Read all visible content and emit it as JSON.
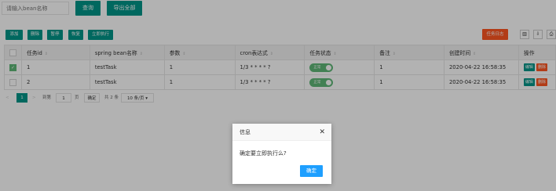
{
  "search": {
    "placeholder": "请输入bean名称",
    "query_label": "查询",
    "export_label": "导出全部"
  },
  "toolbar": {
    "add": "添加",
    "delete": "删除",
    "pause": "暂停",
    "resume": "恢复",
    "run_now": "立即执行",
    "task_log": "任务日志",
    "tools": [
      {
        "icon": "columns-icon",
        "glyph": "▥"
      },
      {
        "icon": "export-icon",
        "glyph": "⇩"
      },
      {
        "icon": "print-icon",
        "glyph": "⎙"
      }
    ]
  },
  "table": {
    "headers": [
      "任务id",
      "spring bean名称",
      "参数",
      "cron表达式",
      "任务状态",
      "备注",
      "创建时间",
      "操作"
    ],
    "rows": [
      {
        "checked": true,
        "id": "1",
        "bean": "testTask",
        "params": "1",
        "cron": "1/3 * * * * ?",
        "status": "正常",
        "remark": "1",
        "created": "2020-04-22 16:58:35",
        "edit": "编辑",
        "del": "删除"
      },
      {
        "checked": false,
        "id": "2",
        "bean": "testTask",
        "params": "1",
        "cron": "1/3 * * * * ?",
        "status": "正常",
        "remark": "1",
        "created": "2020-04-22 16:58:35",
        "edit": "编辑",
        "del": "删除"
      }
    ]
  },
  "pager": {
    "prev": "<",
    "current": "1",
    "next": ">",
    "goto": "到第",
    "page_input": "1",
    "page_unit": "页",
    "confirm": "确定",
    "total": "共 2 条",
    "page_size": "10 条/页 ▾"
  },
  "dialog": {
    "title": "信息",
    "close": "✕",
    "message": "确定要立即执行么?",
    "ok": "确定"
  },
  "colors": {
    "primary": "#009688",
    "danger": "#FF5722",
    "blue": "#1E9FFF",
    "switch_on": "#5FB878"
  }
}
